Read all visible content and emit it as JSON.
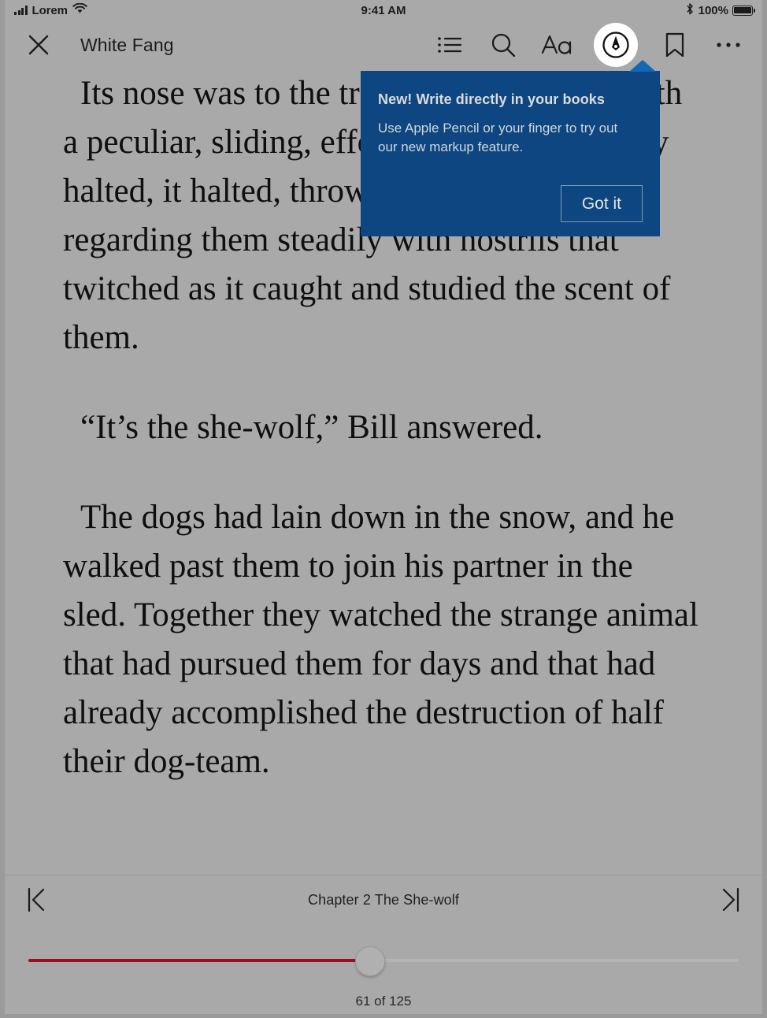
{
  "status_bar": {
    "carrier": "Lorem",
    "wifi_icon": "wifi-icon",
    "signal_icon": "cellular-signal-icon",
    "time": "9:41 AM",
    "bluetooth_icon": "bluetooth-icon",
    "battery_percent": "100%",
    "battery_icon": "battery-full-icon"
  },
  "toolbar": {
    "close_icon": "close-icon",
    "title": "White Fang",
    "icons": [
      {
        "name": "table-of-contents-icon",
        "label": "Contents"
      },
      {
        "name": "search-icon",
        "label": "Search"
      },
      {
        "name": "text-options-icon",
        "label": "Aa"
      },
      {
        "name": "markup-pen-icon",
        "label": "Markup"
      },
      {
        "name": "bookmark-icon",
        "label": "Bookmark"
      },
      {
        "name": "more-options-icon",
        "label": "More"
      }
    ]
  },
  "popover": {
    "title": "New! Write directly in your books",
    "body": "Use Apple Pencil or your finger to try out our new markup feature.",
    "button_label": "Got it",
    "background_color": "#0d4680",
    "arrow_color": "#1268b3"
  },
  "content": {
    "paragraphs": [
      "Its nose was to the trail, and it travelled with a peculiar, sliding, effortless gait. When they halted, it halted, throwing up its head and regarding them steadily with nostrils that twitched as it caught and studied the scent of them.",
      "“It’s the she-wolf,” Bill answered.",
      "The dogs had lain down in the snow, and he walked past them to join his partner in the sled.  Together they watched the strange animal that had pursued them for days and that had already accomplished the destruction of half their dog-team."
    ]
  },
  "bottom_bar": {
    "prev_chapter_icon": "skip-to-previous-chapter-icon",
    "next_chapter_icon": "skip-to-next-chapter-icon",
    "chapter_label": "Chapter 2 The She-wolf",
    "page_indicator": "61 of 125",
    "progress_percent": 48,
    "progress_color": "#9b0e21",
    "track_color": "#b4b4b4"
  },
  "theme": {
    "page_background": "#a9a9a9",
    "text_color": "#0f0f0f"
  }
}
